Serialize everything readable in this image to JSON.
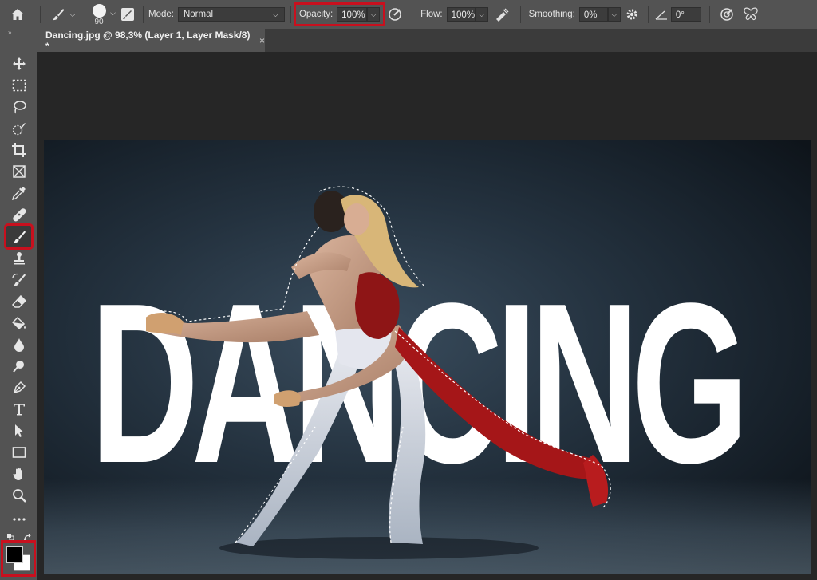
{
  "options_bar": {
    "brush_size": "90",
    "mode_label": "Mode:",
    "mode_value": "Normal",
    "opacity_label": "Opacity:",
    "opacity_value": "100%",
    "flow_label": "Flow:",
    "flow_value": "100%",
    "smoothing_label": "Smoothing:",
    "smoothing_value": "0%",
    "angle_value": "0°"
  },
  "tab": {
    "title": "Dancing.jpg @ 98,3% (Layer 1, Layer Mask/8) *",
    "close": "×"
  },
  "toolbar": {
    "collapse": "»",
    "tools": [
      "move-icon",
      "marquee-icon",
      "lasso-icon",
      "quick-select-icon",
      "crop-icon",
      "frame-icon",
      "eyedropper-icon",
      "healing-icon",
      "brush-icon",
      "stamp-icon",
      "history-brush-icon",
      "eraser-icon",
      "paint-bucket-icon",
      "blur-icon",
      "dodge-icon",
      "pen-icon",
      "type-icon",
      "path-select-icon",
      "rectangle-icon",
      "hand-icon",
      "zoom-icon",
      "more-icon"
    ],
    "foreground_color": "#000000",
    "background_color": "#ffffff"
  },
  "canvas": {
    "headline": "DANCING"
  },
  "highlight_color": "#c8101e"
}
